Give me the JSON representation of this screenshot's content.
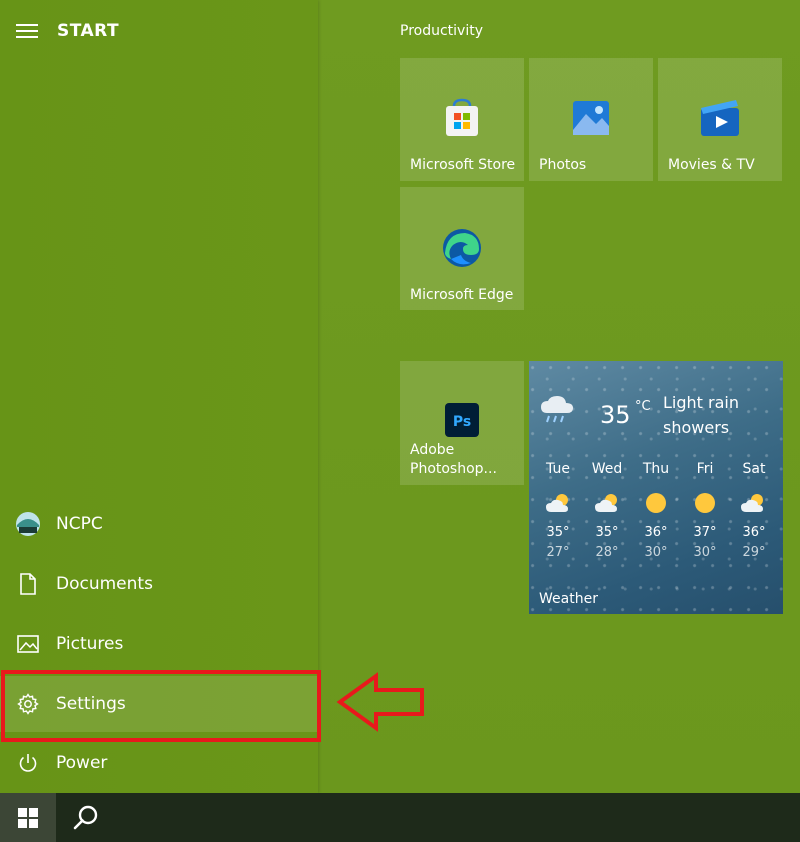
{
  "header": {
    "title": "START"
  },
  "menu": {
    "user": "NCPC",
    "documents": "Documents",
    "pictures": "Pictures",
    "settings": "Settings",
    "power": "Power"
  },
  "group": {
    "title": "Productivity"
  },
  "tiles": {
    "store": "Microsoft Store",
    "photos": "Photos",
    "movies": "Movies & TV",
    "edge": "Microsoft Edge",
    "photoshop_line1": "Adobe",
    "photoshop_line2": "Photoshop..."
  },
  "weather": {
    "temp": "35",
    "unit": "°C",
    "cond_line1": "Light rain",
    "cond_line2": "showers",
    "label": "Weather",
    "days": [
      {
        "day": "Tue",
        "hi": "35°",
        "lo": "27°",
        "icon": "partly-cloudy-icon"
      },
      {
        "day": "Wed",
        "hi": "35°",
        "lo": "28°",
        "icon": "partly-cloudy-icon"
      },
      {
        "day": "Thu",
        "hi": "36°",
        "lo": "30°",
        "icon": "sunny-icon"
      },
      {
        "day": "Fri",
        "hi": "37°",
        "lo": "30°",
        "icon": "sunny-icon"
      },
      {
        "day": "Sat",
        "hi": "36°",
        "lo": "29°",
        "icon": "partly-cloudy-icon"
      }
    ]
  },
  "colors": {
    "accent": "#6b971d",
    "highlight": "#e8191c",
    "taskbar": "#1e2a1a"
  }
}
